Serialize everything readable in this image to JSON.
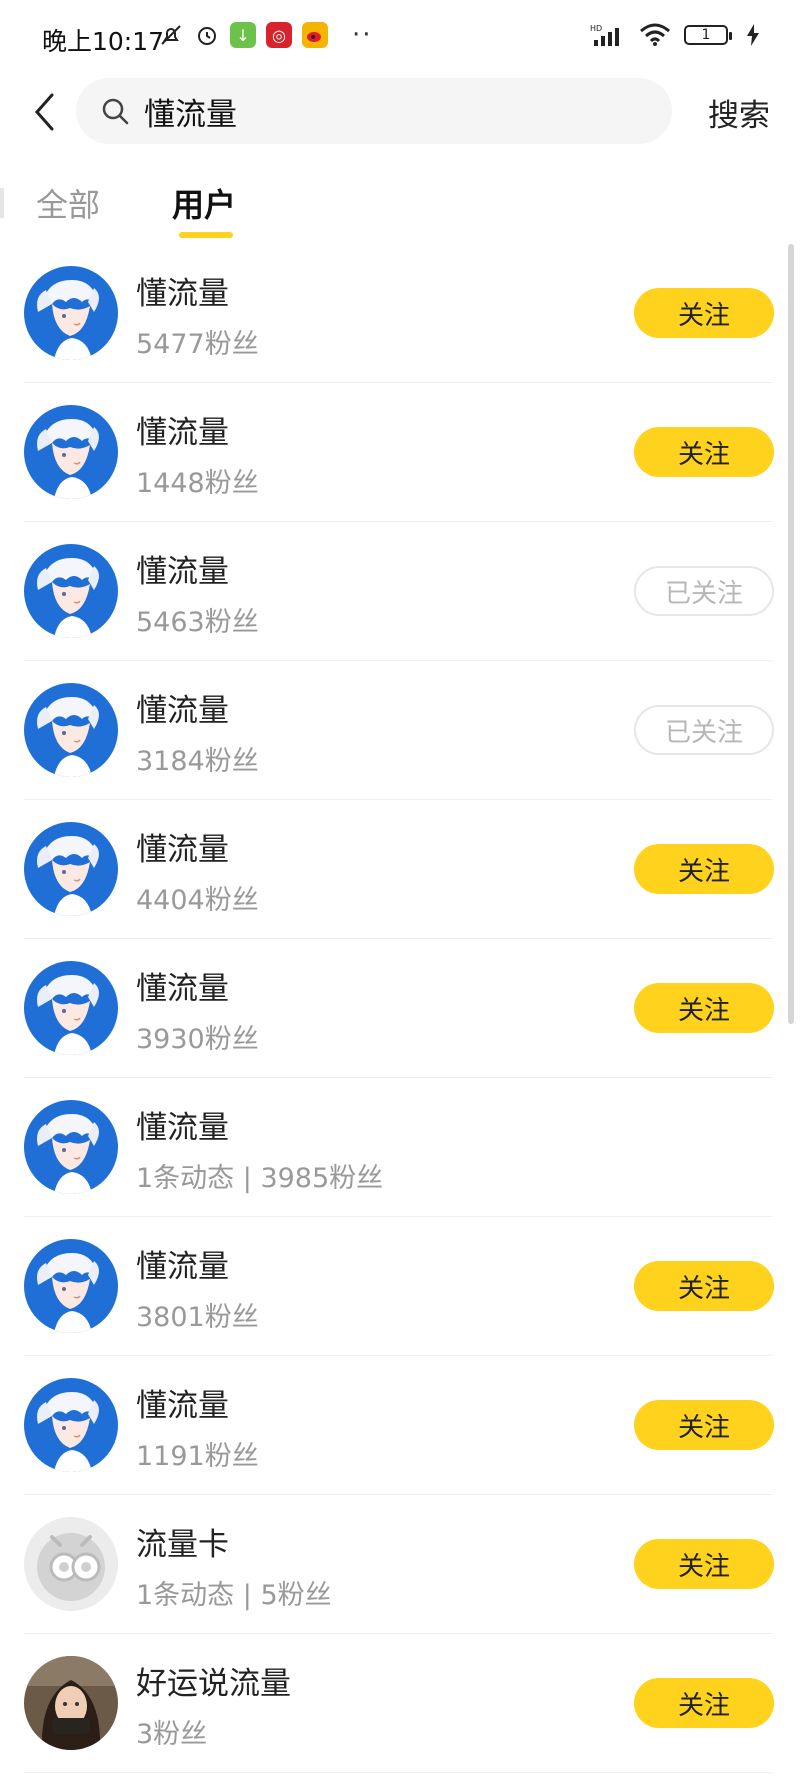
{
  "status_bar": {
    "time": "晚上10:17",
    "dots": "··",
    "battery": "1",
    "signal_label": "HD"
  },
  "search": {
    "query": "懂流量",
    "search_button": "搜索"
  },
  "tabs": [
    {
      "label": "全部"
    },
    {
      "label": "用户"
    }
  ],
  "users": [
    {
      "name": "懂流量",
      "meta": "5477粉丝",
      "button": "关注",
      "avatar": "anime-boy"
    },
    {
      "name": "懂流量",
      "meta": "1448粉丝",
      "button": "关注",
      "avatar": "anime-boy"
    },
    {
      "name": "懂流量",
      "meta": "5463粉丝",
      "button": "已关注",
      "avatar": "anime-boy"
    },
    {
      "name": "懂流量",
      "meta": "3184粉丝",
      "button": "已关注",
      "avatar": "anime-boy"
    },
    {
      "name": "懂流量",
      "meta": "4404粉丝",
      "button": "关注",
      "avatar": "anime-boy"
    },
    {
      "name": "懂流量",
      "meta": "3930粉丝",
      "button": "关注",
      "avatar": "anime-boy"
    },
    {
      "name": "懂流量",
      "meta": "1条动态 | 3985粉丝",
      "button": "",
      "avatar": "anime-boy"
    },
    {
      "name": "懂流量",
      "meta": "3801粉丝",
      "button": "关注",
      "avatar": "anime-boy"
    },
    {
      "name": "懂流量",
      "meta": "1191粉丝",
      "button": "关注",
      "avatar": "anime-boy"
    },
    {
      "name": "流量卡",
      "meta": "1条动态 | 5粉丝",
      "button": "关注",
      "avatar": "gray-robot"
    },
    {
      "name": "好运说流量",
      "meta": "3粉丝",
      "button": "关注",
      "avatar": "photo-woman"
    }
  ],
  "colors": {
    "accent": "#ffd21e",
    "avatar_blue": "#1f6fd6",
    "muted_text": "#999999"
  }
}
